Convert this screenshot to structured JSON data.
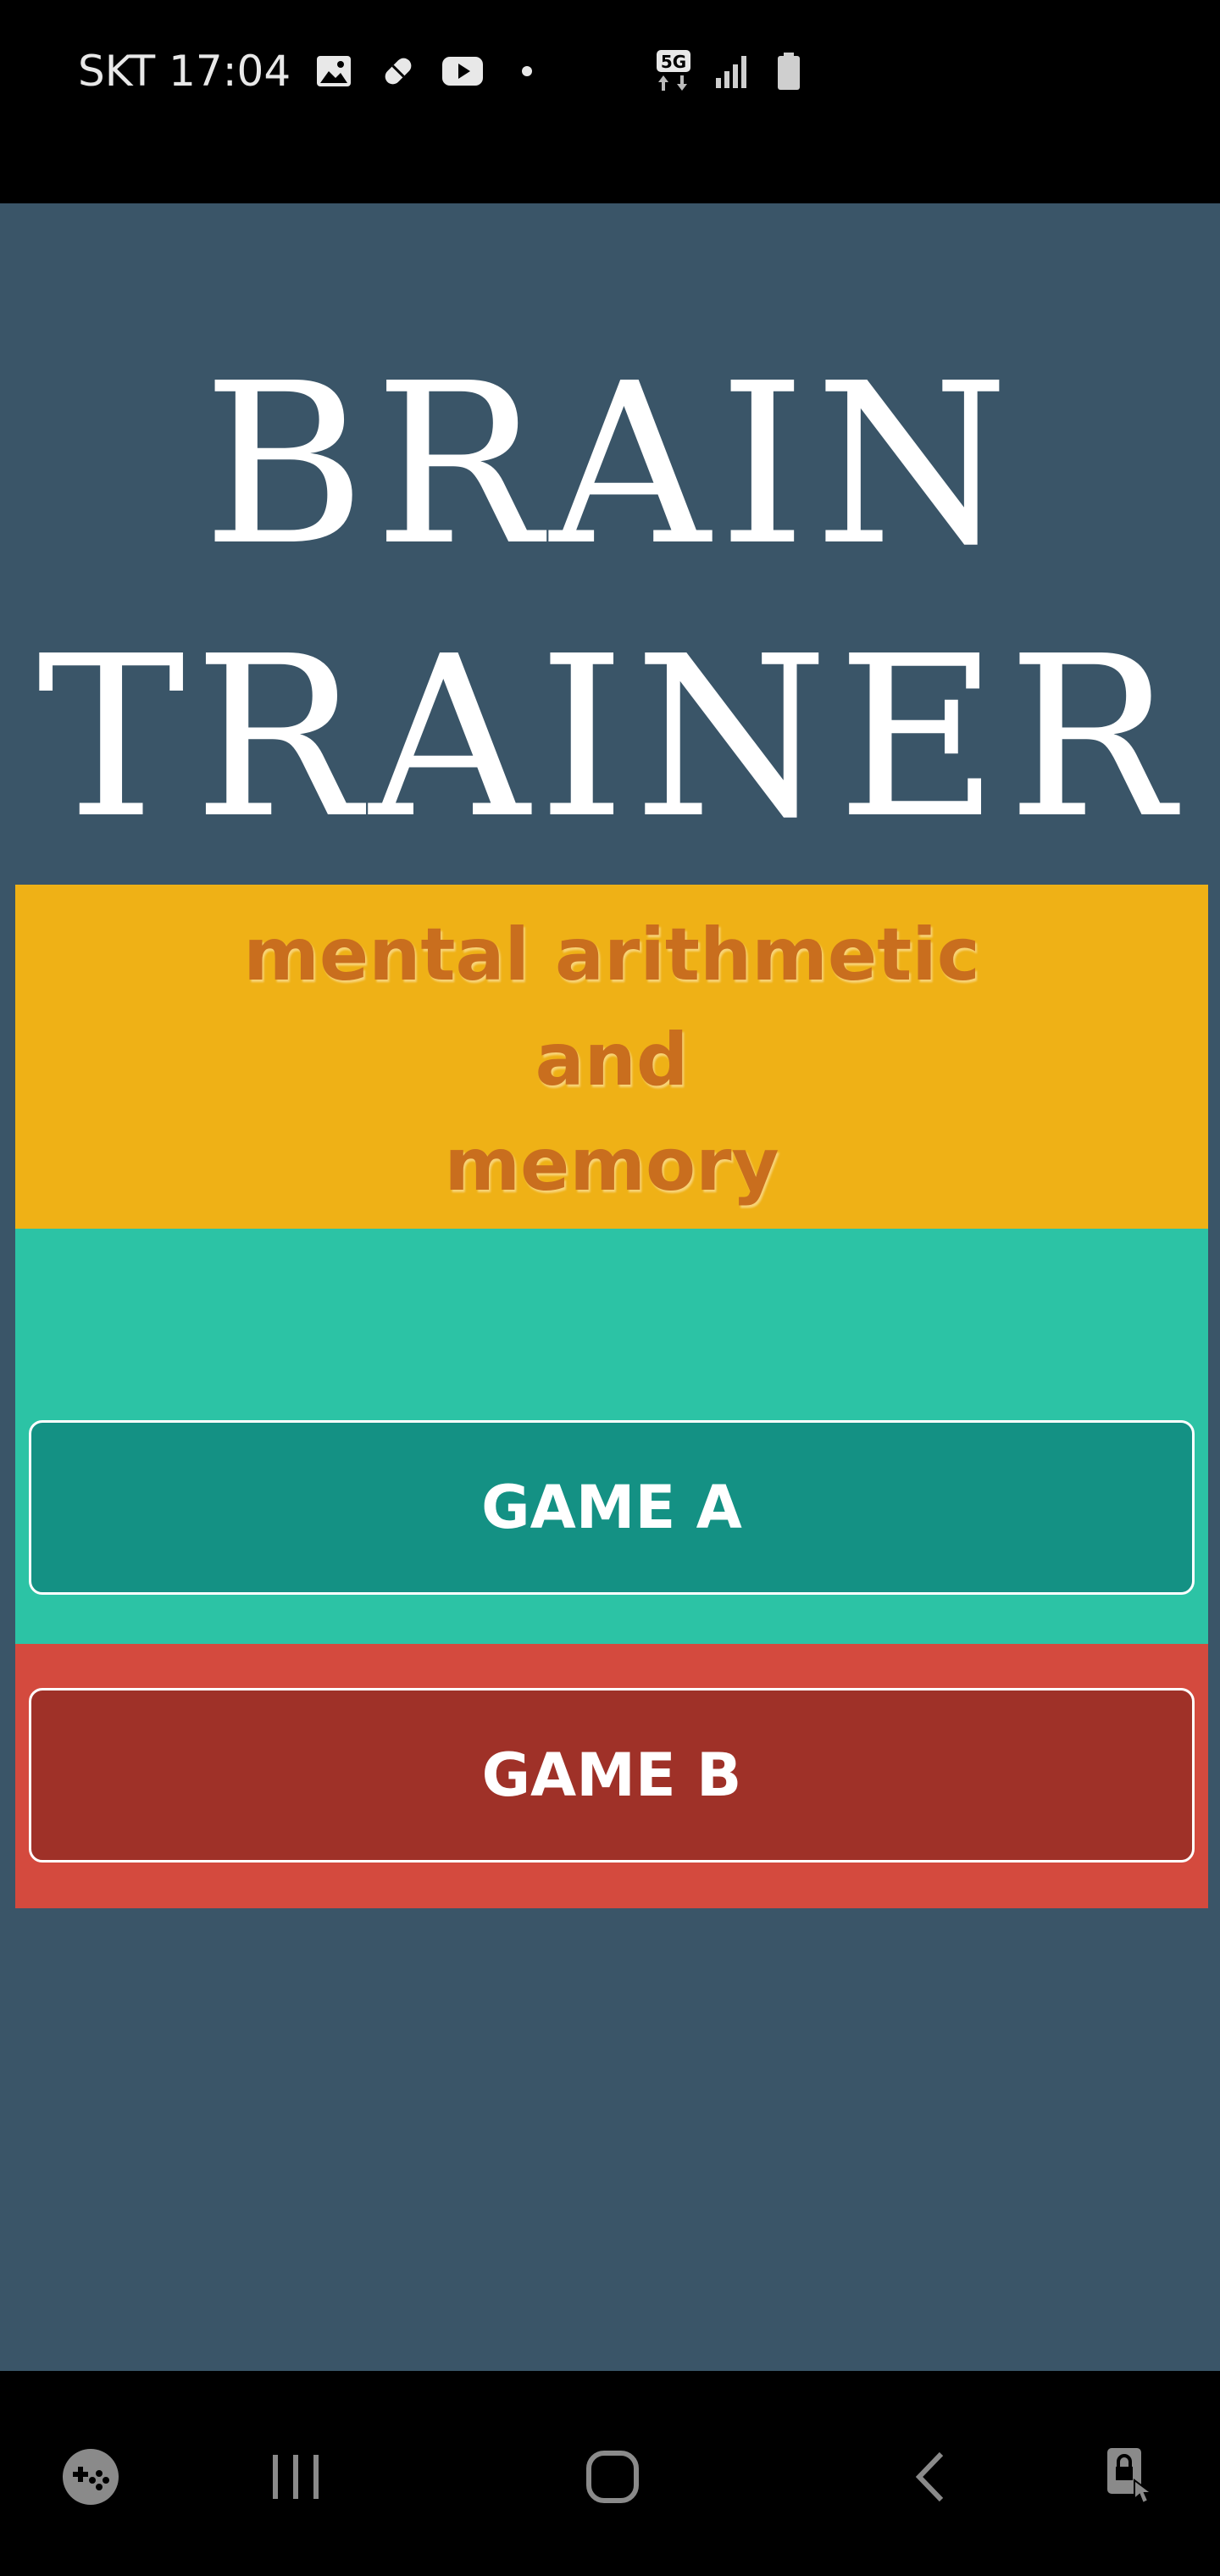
{
  "status_bar": {
    "carrier_time": "SKT 17:04",
    "network": "5G",
    "left_icons": [
      "image-icon",
      "pill-icon",
      "youtube-icon",
      "dot-icon"
    ],
    "right_icons": [
      "5g-icon",
      "signal-icon",
      "battery-icon"
    ]
  },
  "app": {
    "title_line1": "BRAIN",
    "title_line2": "TRAINER",
    "subtitle_line1": "mental arithmetic",
    "subtitle_line2": "and",
    "subtitle_line3": "memory",
    "game_a_label": "GAME A",
    "game_b_label": "GAME B"
  },
  "nav_bar": {
    "items": [
      "game-launcher-icon",
      "recent-apps-icon",
      "home-icon",
      "back-icon",
      "screen-lock-icon"
    ]
  },
  "colors": {
    "background": "#3a5568",
    "subtitle_panel": "#efb116",
    "subtitle_text": "#c96e1e",
    "panel_a": "#2cc3a5",
    "button_a": "#149184",
    "panel_b": "#d44a3e",
    "button_b": "#9f3128"
  }
}
